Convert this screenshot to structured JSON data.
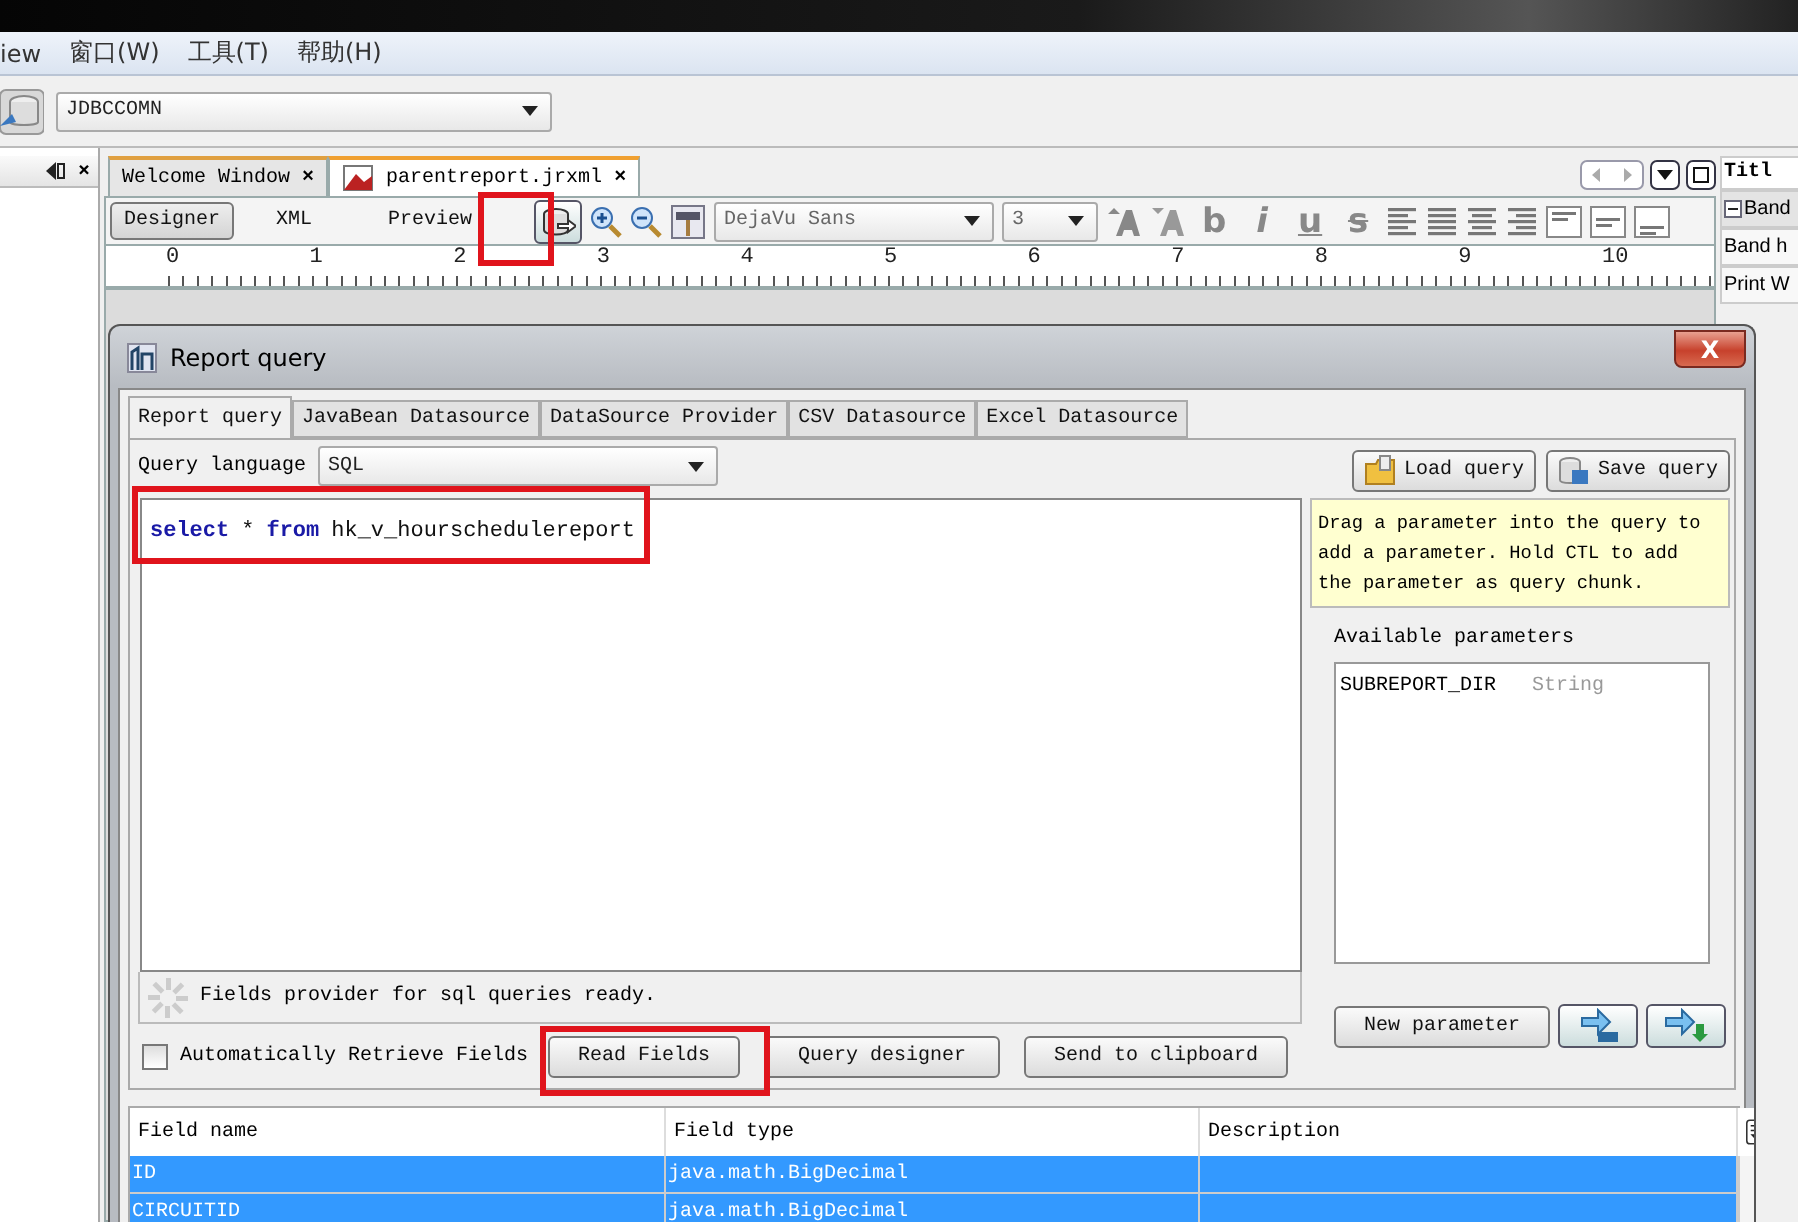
{
  "menu": [
    "iew",
    "窗口(W)",
    "工具(T)",
    "帮助(H)"
  ],
  "connection": {
    "value": "JDBCCOMN"
  },
  "left_panel": {
    "close": "×"
  },
  "editor_tabs": [
    {
      "label": "Welcome Window",
      "close": "×",
      "selected": false
    },
    {
      "label": "parentreport.jrxml",
      "close": "×",
      "selected": true
    }
  ],
  "view_modes": [
    {
      "label": "Designer",
      "selected": true
    },
    {
      "label": "XML",
      "selected": false
    },
    {
      "label": "Preview",
      "selected": false
    }
  ],
  "font": {
    "value": "DejaVu Sans"
  },
  "font_size": {
    "value": "3"
  },
  "text_styles": [
    "b",
    "i",
    "u",
    "s"
  ],
  "ruler": [
    "0",
    "1",
    "2",
    "3",
    "4",
    "5",
    "6",
    "7",
    "8",
    "9",
    "10"
  ],
  "properties": [
    {
      "label": "Titl",
      "kind": "title"
    },
    {
      "label": "Band",
      "kind": "group"
    },
    {
      "label": "Band h",
      "kind": "row"
    },
    {
      "label": "Print W",
      "kind": "row"
    }
  ],
  "dialog": {
    "title": "Report query",
    "close": "X",
    "tabs": [
      {
        "label": "Report query",
        "selected": true
      },
      {
        "label": "JavaBean Datasource",
        "selected": false
      },
      {
        "label": "DataSource Provider",
        "selected": false
      },
      {
        "label": "CSV Datasource",
        "selected": false
      },
      {
        "label": "Excel Datasource",
        "selected": false
      }
    ],
    "query_language_label": "Query language",
    "query_language": "SQL",
    "load_button": "Load query",
    "save_button": "Save query",
    "query": [
      {
        "text": "select",
        "kind": "keyword"
      },
      {
        "text": "*",
        "kind": "plain"
      },
      {
        "text": "from",
        "kind": "keyword"
      },
      {
        "text": "hk_v_hourschedulereport",
        "kind": "plain"
      }
    ],
    "hint": "Drag a parameter into the query to add a parameter. Hold CTL to add the parameter as query chunk.",
    "parameters_title": "Available parameters",
    "parameters": [
      {
        "name": "SUBREPORT_DIR",
        "type": "String"
      }
    ],
    "status": "Fields provider for sql queries ready.",
    "auto_retrieve": {
      "label": "Automatically Retrieve Fields",
      "checked": false
    },
    "actions": [
      "Read Fields",
      "Query designer",
      "Send to clipboard"
    ],
    "new_parameter": "New parameter",
    "table": {
      "columns": [
        "Field name",
        "Field type",
        "Description"
      ],
      "rows": [
        {
          "cells": [
            "ID",
            "java.math.BigDecimal"
          ],
          "selected": true
        },
        {
          "cells": [
            "CIRCUITID",
            "java.math.BigDecimal"
          ],
          "selected": true
        }
      ]
    }
  }
}
